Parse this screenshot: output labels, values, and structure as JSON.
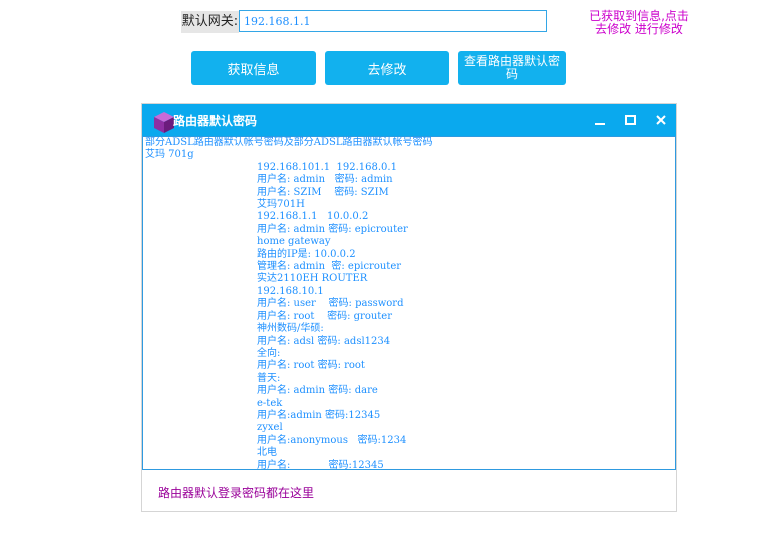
{
  "gateway": {
    "label": "默认网关:",
    "value": "192.168.1.1"
  },
  "hint": {
    "line1": "已获取到信息,点击",
    "line2": "去修改  进行修改"
  },
  "buttons": {
    "get_info": "获取信息",
    "modify": "去修改",
    "view_default_line1": "查看路由器默认密",
    "view_default_line2": "码"
  },
  "dialog": {
    "title": "路由器默认密码",
    "content_head": [
      "部分ADSL路由器默认帐号密码及部分ADSL路由器默认帐号密码",
      "艾玛 701g"
    ],
    "content_lines": [
      "192.168.101.1  192.168.0.1",
      "用户名: admin   密码: admin",
      "用户名: SZIM    密码: SZIM",
      "艾玛701H",
      "192.168.1.1   10.0.0.2",
      "用户名: admin 密码: epicrouter",
      "home gateway",
      "路由的IP是: 10.0.0.2",
      "管理名: admin  密: epicrouter",
      "实达2110EH ROUTER",
      "192.168.10.1",
      "用户名: user    密码: password",
      "用户名: root    密码: grouter",
      "神州数码/华硕:",
      "用户名: adsl 密码: adsl1234",
      "全向:",
      "用户名: root 密码: root",
      "普天:",
      "用户名: admin 密码: dare",
      "e-tek",
      "用户名:admin 密码:12345",
      "zyxel",
      "用户名:anonymous   密码:1234",
      "北电",
      "用户名:            密码:12345"
    ],
    "footer": "路由器默认登录密码都在这里"
  },
  "colors": {
    "accent": "#12b1ee",
    "titlebar": "#0aa9ee",
    "content_text": "#1e90ff",
    "hint": "#cc00cc",
    "footer": "#990099"
  }
}
